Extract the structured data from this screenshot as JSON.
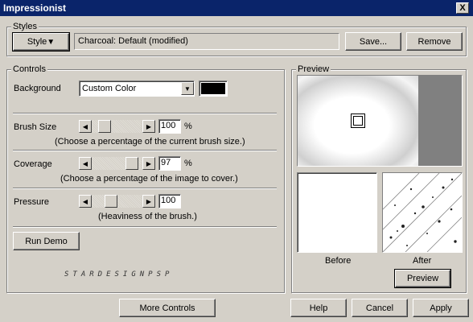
{
  "window": {
    "title": "Impressionist",
    "close_glyph": "X"
  },
  "styles": {
    "legend": "Styles",
    "style_button": "Style",
    "style_arrow": "▼",
    "current": "Charcoal: Default (modified)",
    "save_label": "Save...",
    "remove_label": "Remove"
  },
  "controls": {
    "legend": "Controls",
    "background": {
      "label": "Background",
      "value": "Custom Color",
      "color": "#000000"
    },
    "brush_size": {
      "label": "Brush Size",
      "value": "100",
      "unit": "%",
      "hint": "(Choose a percentage of the current brush size.)",
      "fraction": 0.18
    },
    "coverage": {
      "label": "Coverage",
      "value": "97",
      "unit": "%",
      "hint": "(Choose a percentage of the image to cover.)",
      "fraction": 0.92
    },
    "pressure": {
      "label": "Pressure",
      "value": "100",
      "unit": "",
      "hint": "(Heaviness of the brush.)",
      "fraction": 0.35
    },
    "run_demo_label": "Run Demo",
    "watermark": "STARDESIGNPSP"
  },
  "preview": {
    "legend": "Preview",
    "before_label": "Before",
    "after_label": "After",
    "preview_button": "Preview"
  },
  "footer": {
    "more_controls": "More Controls",
    "help": "Help",
    "cancel": "Cancel",
    "apply": "Apply"
  },
  "colors": {
    "titlebar": "#0a246a",
    "face": "#d4d0c8"
  }
}
